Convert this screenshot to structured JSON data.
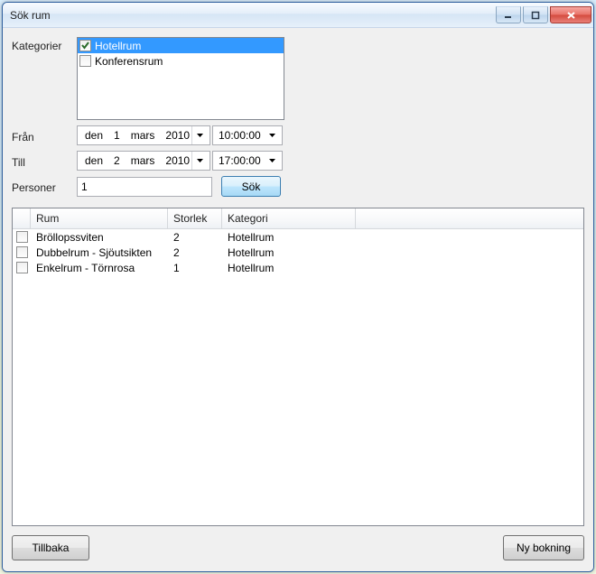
{
  "window": {
    "title": "Sök rum"
  },
  "labels": {
    "categories": "Kategorier",
    "from": "Från",
    "to": "Till",
    "persons": "Personer"
  },
  "categories": [
    {
      "label": "Hotellrum",
      "checked": true,
      "selected": true
    },
    {
      "label": "Konferensrum",
      "checked": false,
      "selected": false
    }
  ],
  "from": {
    "prefix": "den",
    "day": "1",
    "month": "mars",
    "year": "2010",
    "time": "10:00:00"
  },
  "to": {
    "prefix": "den",
    "day": "2",
    "month": "mars",
    "year": "2010",
    "time": "17:00:00"
  },
  "persons": "1",
  "buttons": {
    "search": "Sök",
    "back": "Tillbaka",
    "new_booking": "Ny bokning"
  },
  "grid": {
    "headers": {
      "room": "Rum",
      "size": "Storlek",
      "category": "Kategori"
    },
    "rows": [
      {
        "room": "Bröllopssviten",
        "size": "2",
        "category": "Hotellrum",
        "checked": false
      },
      {
        "room": "Dubbelrum - Sjöutsikten",
        "size": "2",
        "category": "Hotellrum",
        "checked": false
      },
      {
        "room": "Enkelrum - Törnrosa",
        "size": "1",
        "category": "Hotellrum",
        "checked": false
      }
    ]
  }
}
